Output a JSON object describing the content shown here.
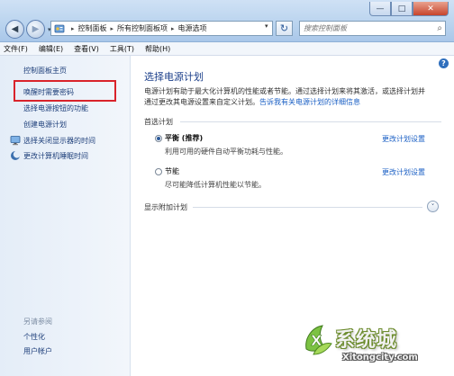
{
  "window": {
    "min_glyph": "—",
    "max_glyph": "□",
    "close_glyph": "✕"
  },
  "nav": {
    "back_glyph": "◀",
    "forward_glyph": "▶",
    "dropdown_glyph": "▾",
    "refresh_glyph": "↻"
  },
  "address": {
    "breadcrumbs": [
      "控制面板",
      "所有控制面板项",
      "电源选项"
    ],
    "separator": "▸"
  },
  "search": {
    "placeholder": "搜索控制面板",
    "glyph": "⌕"
  },
  "menu": {
    "items": [
      "文件(F)",
      "编辑(E)",
      "查看(V)",
      "工具(T)",
      "帮助(H)"
    ]
  },
  "help": {
    "glyph": "?"
  },
  "sidebar": {
    "home": "控制面板主页",
    "require_password": "唤醒时需要密码",
    "power_buttons": "选择电源按钮的功能",
    "create_plan": "创建电源计划",
    "display_off": "选择关闭显示器的时间",
    "sleep_time": "更改计算机睡眠时间",
    "see_also_heading": "另请参阅",
    "personalization": "个性化",
    "user_accounts": "用户帐户"
  },
  "main": {
    "title": "选择电源计划",
    "desc_line1": "电源计划有助于最大化计算机的性能或者节能。通过选择计划来将其激活，或选择计划并",
    "desc_line2": "通过更改其电源设置来自定义计划。",
    "desc_link": "告诉我有关电源计划的详细信息",
    "preferred_heading": "首选计划",
    "plans": [
      {
        "name": "平衡 (推荐)",
        "desc": "利用可用的硬件自动平衡功耗与性能。",
        "link": "更改计划设置",
        "selected": true
      },
      {
        "name": "节能",
        "desc": "尽可能降低计算机性能以节能。",
        "link": "更改计划设置",
        "selected": false
      }
    ],
    "additional_heading": "显示附加计划",
    "expand_glyph": "˅"
  },
  "watermark": {
    "text": "系统城",
    "url": "Xitongcity.com"
  },
  "colors": {
    "link": "#1a5fc4",
    "title": "#1b3f8a",
    "highlight": "#d9232b"
  }
}
